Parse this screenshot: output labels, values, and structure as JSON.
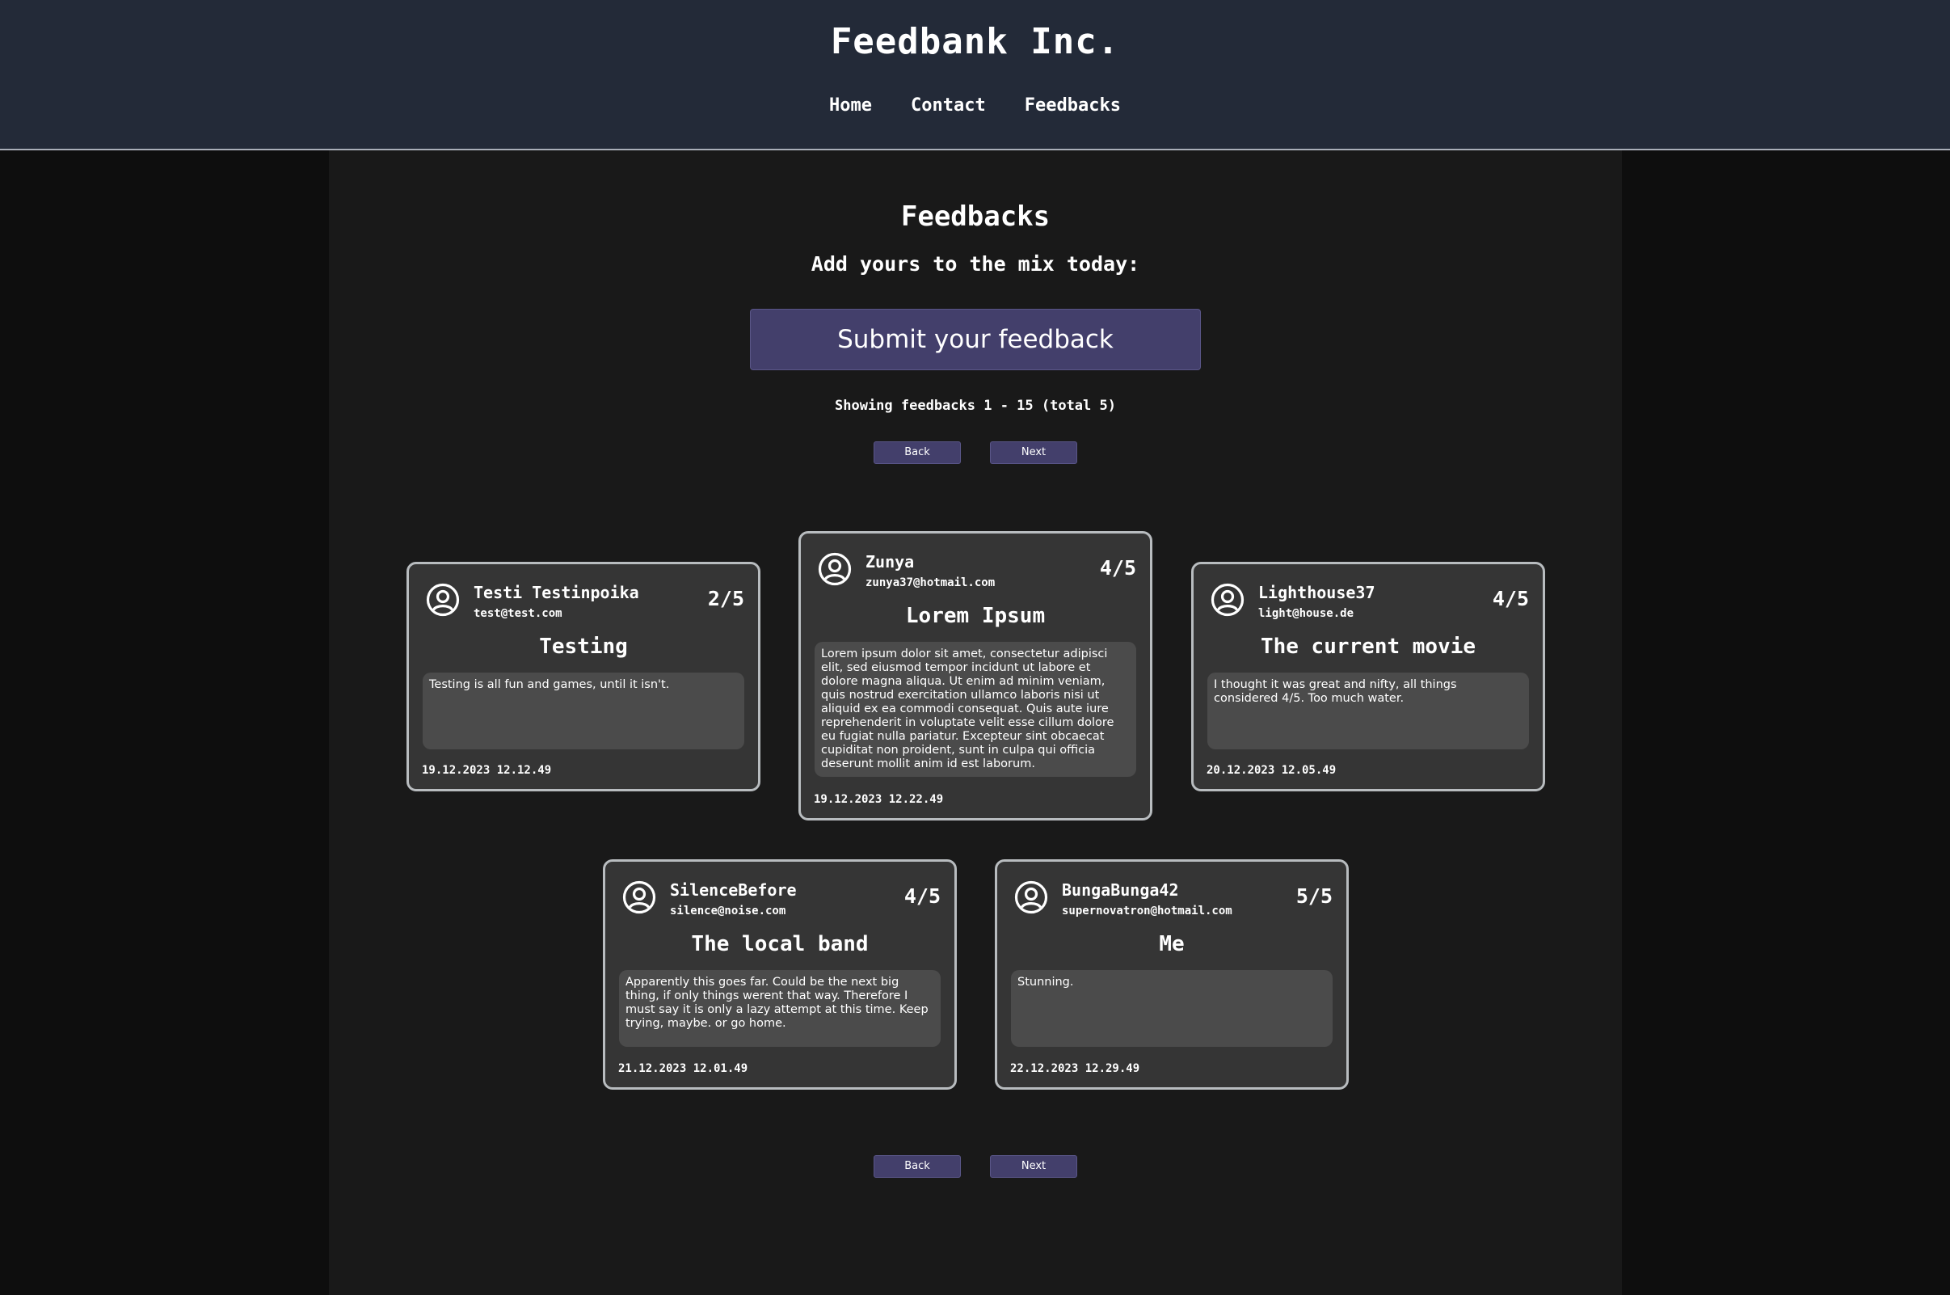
{
  "header": {
    "title": "Feedbank Inc.",
    "nav": [
      "Home",
      "Contact",
      "Feedbacks"
    ]
  },
  "main": {
    "heading": "Feedbacks",
    "subheading": "Add yours to the mix today:",
    "submit_label": "Submit your feedback",
    "showing": "Showing feedbacks 1 - 15 (total 5)",
    "back_label": "Back",
    "next_label": "Next"
  },
  "feedbacks": [
    {
      "name": "Testi Testinpoika",
      "email": "test@test.com",
      "rating": "2/5",
      "title": "Testing",
      "body": "Testing is all fun and games, until it isn't.",
      "date": "19.12.2023 12.12.49"
    },
    {
      "name": "Zunya",
      "email": "zunya37@hotmail.com",
      "rating": "4/5",
      "title": "Lorem Ipsum",
      "body": "Lorem ipsum dolor sit amet, consectetur adipisci elit, sed eiusmod tempor incidunt ut labore et dolore magna aliqua. Ut enim ad minim veniam, quis nostrud exercitation ullamco laboris nisi ut aliquid ex ea commodi consequat. Quis aute iure reprehenderit in voluptate velit esse cillum dolore eu fugiat nulla pariatur. Excepteur sint obcaecat cupiditat non proident, sunt in culpa qui officia deserunt mollit anim id est laborum.",
      "date": "19.12.2023 12.22.49"
    },
    {
      "name": "Lighthouse37",
      "email": "light@house.de",
      "rating": "4/5",
      "title": "The current movie",
      "body": "I thought it was great and nifty, all things considered 4/5. Too much water.",
      "date": "20.12.2023 12.05.49"
    },
    {
      "name": "SilenceBefore",
      "email": "silence@noise.com",
      "rating": "4/5",
      "title": "The local band",
      "body": "Apparently this goes far. Could be the next big thing, if only things werent that way. Therefore I must say it is only a lazy attempt at this time. Keep trying, maybe. or go home.",
      "date": "21.12.2023 12.01.49"
    },
    {
      "name": "BungaBunga42",
      "email": "supernovatron@hotmail.com",
      "rating": "5/5",
      "title": "Me",
      "body": "Stunning.",
      "date": "22.12.2023 12.29.49"
    }
  ],
  "icons": {
    "avatar": "user-circle-icon"
  },
  "colors": {
    "header_bg": "#232a38",
    "page_bg": "#191919",
    "outer_bg": "#0e0e0e",
    "accent": "#433f6b",
    "card_bg": "#353535",
    "card_border": "#b8bcbf",
    "card_body_bg": "#4b4b4b"
  }
}
